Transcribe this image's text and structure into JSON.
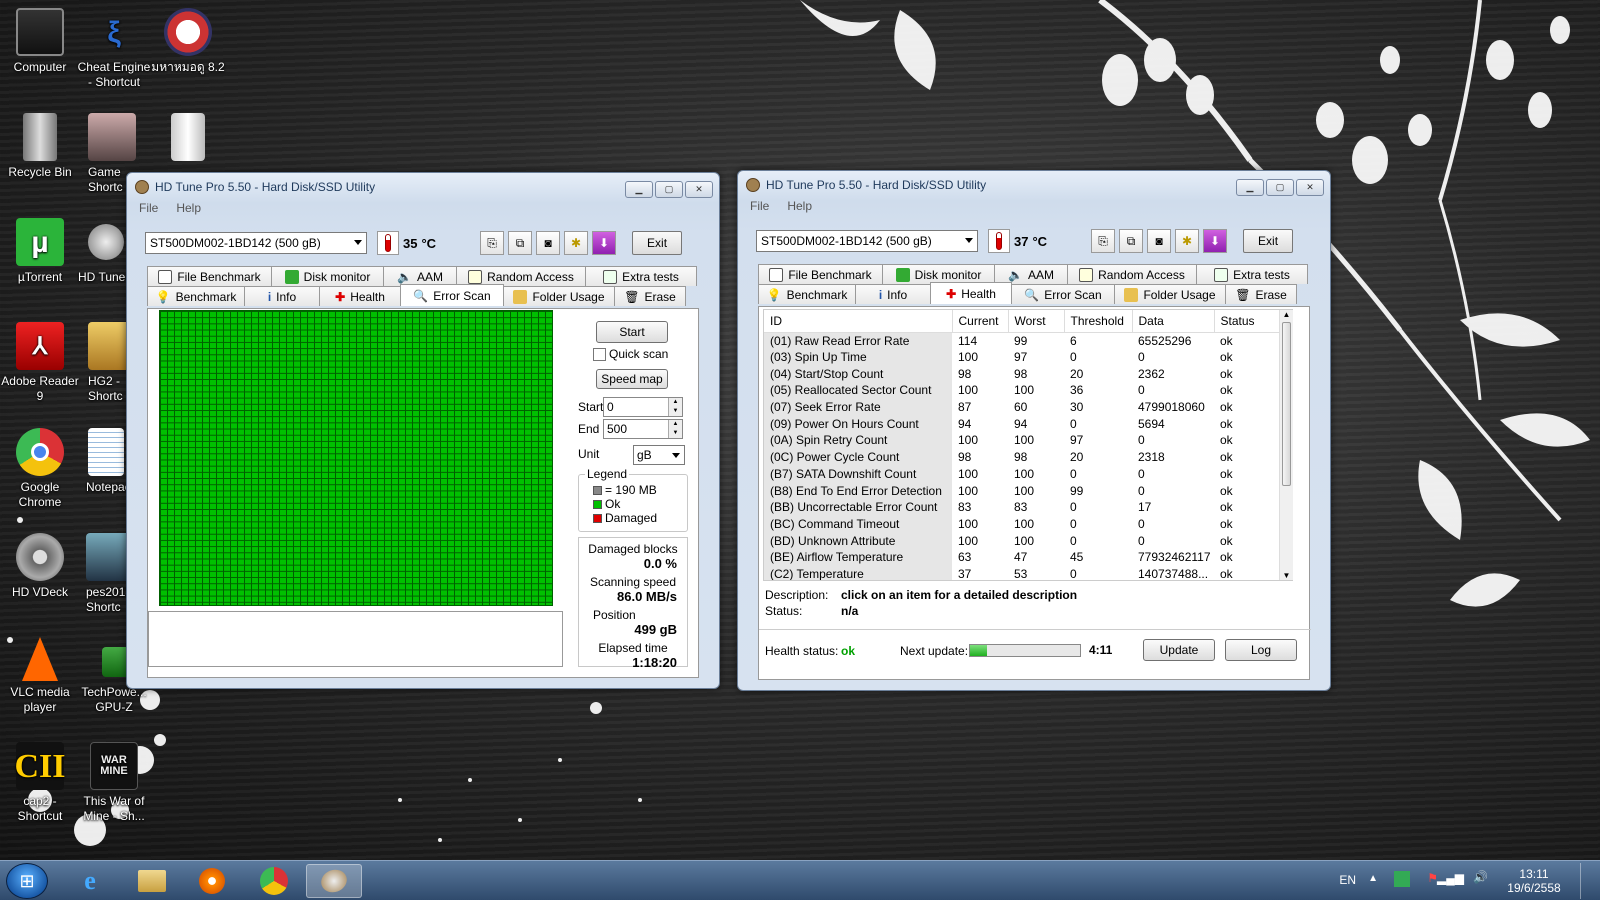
{
  "desktop": {
    "icons": [
      {
        "label": "Computer"
      },
      {
        "label": "Cheat Engine - Shortcut"
      },
      {
        "label": "มหาหมอดู 8.2"
      },
      {
        "label": "Recycle Bin"
      },
      {
        "label": "Game Shortc"
      },
      {
        "label": "µTorrent"
      },
      {
        "label": "HD Tune"
      },
      {
        "label": "Adobe Reader 9"
      },
      {
        "label": "HG2 -Shortc"
      },
      {
        "label": "Google Chrome"
      },
      {
        "label": "Notepac"
      },
      {
        "label": "HD VDeck"
      },
      {
        "label": "pes2013 Shortc"
      },
      {
        "label": "VLC media player"
      },
      {
        "label": "TechPowe... GPU-Z"
      },
      {
        "label": "cap2 - Shortcut"
      },
      {
        "label": "This War of Mine - Sh..."
      }
    ]
  },
  "colors": {
    "scan_ok": "#00c000",
    "damaged": "#e00000",
    "health_ok": "#00a000"
  },
  "win1": {
    "title": "HD Tune Pro 5.50 - Hard Disk/SSD Utility",
    "menu": [
      "File",
      "Help"
    ],
    "drive": "ST500DM002-1BD142 (500 gB)",
    "temp": "35",
    "temp_unit": "°C",
    "exit": "Exit",
    "tabs_top": [
      "File Benchmark",
      "Disk monitor",
      "AAM",
      "Random Access",
      "Extra tests"
    ],
    "tabs_bottom": [
      "Benchmark",
      "Info",
      "Health",
      "Error Scan",
      "Folder Usage",
      "Erase"
    ],
    "start_btn": "Start",
    "quick_scan": "Quick scan",
    "speed_map": "Speed map",
    "start_label": "Start",
    "start_value": "0",
    "end_label": "End",
    "end_value": "500",
    "unit_label": "Unit",
    "unit_value": "gB",
    "legend_title": "Legend",
    "legend_block": "= 190 MB",
    "legend_ok": "Ok",
    "legend_damaged": "Damaged",
    "damaged_blocks_label": "Damaged blocks",
    "damaged_blocks_value": "0.0 %",
    "scanning_speed_label": "Scanning speed",
    "scanning_speed_value": "86.0 MB/s",
    "position_label": "Position",
    "position_value": "499 gB",
    "elapsed_label": "Elapsed time",
    "elapsed_value": "1:18:20"
  },
  "win2": {
    "title": "HD Tune Pro 5.50 - Hard Disk/SSD Utility",
    "menu": [
      "File",
      "Help"
    ],
    "drive": "ST500DM002-1BD142 (500 gB)",
    "temp": "37",
    "temp_unit": "°C",
    "exit": "Exit",
    "tabs_top": [
      "File Benchmark",
      "Disk monitor",
      "AAM",
      "Random Access",
      "Extra tests"
    ],
    "tabs_bottom": [
      "Benchmark",
      "Info",
      "Health",
      "Error Scan",
      "Folder Usage",
      "Erase"
    ],
    "columns": [
      "ID",
      "Current",
      "Worst",
      "Threshold",
      "Data",
      "Status"
    ],
    "rows": [
      [
        "(01) Raw Read Error Rate",
        "114",
        "99",
        "6",
        "65525296",
        "ok"
      ],
      [
        "(03) Spin Up Time",
        "100",
        "97",
        "0",
        "0",
        "ok"
      ],
      [
        "(04) Start/Stop Count",
        "98",
        "98",
        "20",
        "2362",
        "ok"
      ],
      [
        "(05) Reallocated Sector Count",
        "100",
        "100",
        "36",
        "0",
        "ok"
      ],
      [
        "(07) Seek Error Rate",
        "87",
        "60",
        "30",
        "4799018060",
        "ok"
      ],
      [
        "(09) Power On Hours Count",
        "94",
        "94",
        "0",
        "5694",
        "ok"
      ],
      [
        "(0A) Spin Retry Count",
        "100",
        "100",
        "97",
        "0",
        "ok"
      ],
      [
        "(0C) Power Cycle Count",
        "98",
        "98",
        "20",
        "2318",
        "ok"
      ],
      [
        "(B7) SATA Downshift Count",
        "100",
        "100",
        "0",
        "0",
        "ok"
      ],
      [
        "(B8) End To End Error Detection",
        "100",
        "100",
        "99",
        "0",
        "ok"
      ],
      [
        "(BB) Uncorrectable Error Count",
        "83",
        "83",
        "0",
        "17",
        "ok"
      ],
      [
        "(BC) Command Timeout",
        "100",
        "100",
        "0",
        "0",
        "ok"
      ],
      [
        "(BD) Unknown Attribute",
        "100",
        "100",
        "0",
        "0",
        "ok"
      ],
      [
        "(BE) Airflow Temperature",
        "63",
        "47",
        "45",
        "77932462117",
        "ok"
      ],
      [
        "(C2) Temperature",
        "37",
        "53",
        "0",
        "140737488...",
        "ok"
      ]
    ],
    "description_label": "Description:",
    "description_value": "click on an item for a detailed description",
    "status_label": "Status:",
    "status_value": "n/a",
    "health_status_label": "Health status:",
    "health_status_value": "ok",
    "next_update_label": "Next update:",
    "next_update_progress": 0.15,
    "next_update_time": "4:11",
    "update_btn": "Update",
    "log_btn": "Log"
  },
  "tray": {
    "lang": "EN",
    "time": "13:11",
    "date": "19/6/2558"
  }
}
